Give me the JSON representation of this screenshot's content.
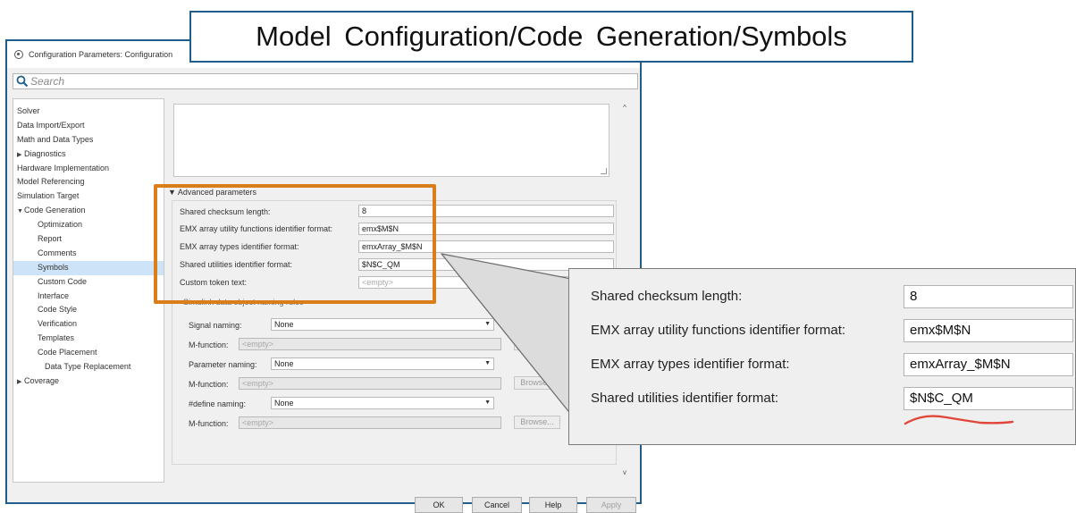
{
  "window": {
    "title": "Configuration Parameters: Configuration",
    "search_placeholder": "Search"
  },
  "banner": {
    "text": "Model Configuration/Code Generation/Symbols"
  },
  "tree": {
    "items": [
      {
        "label": "Solver",
        "level": 0,
        "arrow": ""
      },
      {
        "label": "Data Import/Export",
        "level": 0,
        "arrow": ""
      },
      {
        "label": "Math and Data Types",
        "level": 0,
        "arrow": ""
      },
      {
        "label": "Diagnostics",
        "level": 0,
        "arrow": "▶"
      },
      {
        "label": "Hardware Implementation",
        "level": 0,
        "arrow": ""
      },
      {
        "label": "Model Referencing",
        "level": 0,
        "arrow": ""
      },
      {
        "label": "Simulation Target",
        "level": 0,
        "arrow": ""
      },
      {
        "label": "Code Generation",
        "level": 0,
        "arrow": "▼"
      },
      {
        "label": "Optimization",
        "level": 1,
        "arrow": ""
      },
      {
        "label": "Report",
        "level": 1,
        "arrow": ""
      },
      {
        "label": "Comments",
        "level": 1,
        "arrow": ""
      },
      {
        "label": "Symbols",
        "level": 1,
        "arrow": "",
        "selected": true
      },
      {
        "label": "Custom Code",
        "level": 1,
        "arrow": ""
      },
      {
        "label": "Interface",
        "level": 1,
        "arrow": ""
      },
      {
        "label": "Code Style",
        "level": 1,
        "arrow": ""
      },
      {
        "label": "Verification",
        "level": 1,
        "arrow": ""
      },
      {
        "label": "Templates",
        "level": 1,
        "arrow": ""
      },
      {
        "label": "Code Placement",
        "level": 1,
        "arrow": ""
      },
      {
        "label": "Data Type Replacement",
        "level": 2,
        "arrow": ""
      },
      {
        "label": "Coverage",
        "level": 0,
        "arrow": "▶"
      }
    ]
  },
  "advanced": {
    "header": "▼ Advanced parameters",
    "checksum_label": "Shared checksum length:",
    "checksum_value": "8",
    "emx_util_label": "EMX array utility functions identifier format:",
    "emx_util_value": "emx$M$N",
    "emx_types_label": "EMX array types identifier format:",
    "emx_types_value": "emxArray_$M$N",
    "shared_util_label": "Shared utilities identifier format:",
    "shared_util_value": "$N$C_QM",
    "custom_token_label": "Custom token text:",
    "custom_token_placeholder": "<empty>"
  },
  "naming": {
    "header": "Simulink data object naming rules",
    "signal_label": "Signal naming:",
    "signal_value": "None",
    "mfunction_label": "M-function:",
    "mfunction_placeholder": "<empty>",
    "parameter_label": "Parameter naming:",
    "parameter_value": "None",
    "define_label": "#define naming:",
    "define_value": "None",
    "browse_label": "Browse..."
  },
  "buttons": {
    "ok": "OK",
    "cancel": "Cancel",
    "help": "Help",
    "apply": "Apply"
  },
  "zoom": {
    "checksum_label": "Shared checksum length:",
    "checksum_value": "8",
    "emx_util_label": "EMX array utility functions identifier format:",
    "emx_util_value": "emx$M$N",
    "emx_types_label": "EMX array types identifier format:",
    "emx_types_value": "emxArray_$M$N",
    "shared_util_label": "Shared utilities identifier format:",
    "shared_util_value": "$N$C_QM"
  },
  "colors": {
    "highlight": "#d97e1a",
    "window_border": "#1f5e8c",
    "annotation": "#e0473a",
    "selection": "#cde3f7"
  }
}
